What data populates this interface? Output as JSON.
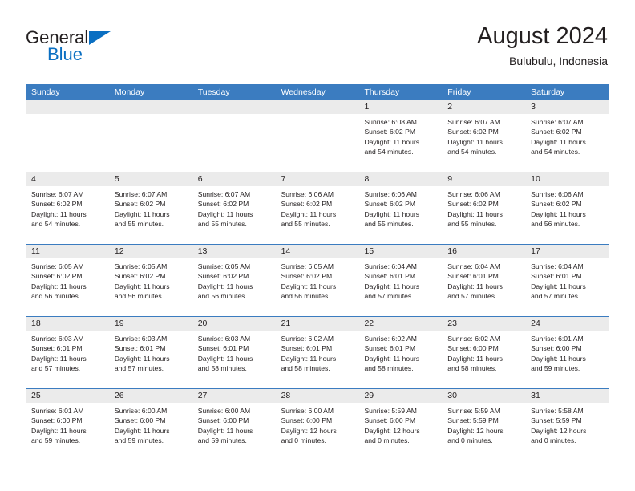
{
  "brand": {
    "name_part1": "General",
    "name_part2": "Blue",
    "logo_icon": "triangle-flag-icon",
    "accent_color": "#0a6fc2"
  },
  "header": {
    "title": "August 2024",
    "subtitle": "Bulubulu, Indonesia"
  },
  "calendar": {
    "header_bg_color": "#3b7cc0",
    "day_band_color": "#ebebeb",
    "day_names": [
      "Sunday",
      "Monday",
      "Tuesday",
      "Wednesday",
      "Thursday",
      "Friday",
      "Saturday"
    ],
    "weeks": [
      [
        {
          "day": "",
          "empty": true,
          "sunrise": "",
          "sunset": "",
          "daylight_line1": "",
          "daylight_line2": ""
        },
        {
          "day": "",
          "empty": true,
          "sunrise": "",
          "sunset": "",
          "daylight_line1": "",
          "daylight_line2": ""
        },
        {
          "day": "",
          "empty": true,
          "sunrise": "",
          "sunset": "",
          "daylight_line1": "",
          "daylight_line2": ""
        },
        {
          "day": "",
          "empty": true,
          "sunrise": "",
          "sunset": "",
          "daylight_line1": "",
          "daylight_line2": ""
        },
        {
          "day": "1",
          "sunrise": "Sunrise: 6:08 AM",
          "sunset": "Sunset: 6:02 PM",
          "daylight_line1": "Daylight: 11 hours",
          "daylight_line2": "and 54 minutes."
        },
        {
          "day": "2",
          "sunrise": "Sunrise: 6:07 AM",
          "sunset": "Sunset: 6:02 PM",
          "daylight_line1": "Daylight: 11 hours",
          "daylight_line2": "and 54 minutes."
        },
        {
          "day": "3",
          "sunrise": "Sunrise: 6:07 AM",
          "sunset": "Sunset: 6:02 PM",
          "daylight_line1": "Daylight: 11 hours",
          "daylight_line2": "and 54 minutes."
        }
      ],
      [
        {
          "day": "4",
          "sunrise": "Sunrise: 6:07 AM",
          "sunset": "Sunset: 6:02 PM",
          "daylight_line1": "Daylight: 11 hours",
          "daylight_line2": "and 54 minutes."
        },
        {
          "day": "5",
          "sunrise": "Sunrise: 6:07 AM",
          "sunset": "Sunset: 6:02 PM",
          "daylight_line1": "Daylight: 11 hours",
          "daylight_line2": "and 55 minutes."
        },
        {
          "day": "6",
          "sunrise": "Sunrise: 6:07 AM",
          "sunset": "Sunset: 6:02 PM",
          "daylight_line1": "Daylight: 11 hours",
          "daylight_line2": "and 55 minutes."
        },
        {
          "day": "7",
          "sunrise": "Sunrise: 6:06 AM",
          "sunset": "Sunset: 6:02 PM",
          "daylight_line1": "Daylight: 11 hours",
          "daylight_line2": "and 55 minutes."
        },
        {
          "day": "8",
          "sunrise": "Sunrise: 6:06 AM",
          "sunset": "Sunset: 6:02 PM",
          "daylight_line1": "Daylight: 11 hours",
          "daylight_line2": "and 55 minutes."
        },
        {
          "day": "9",
          "sunrise": "Sunrise: 6:06 AM",
          "sunset": "Sunset: 6:02 PM",
          "daylight_line1": "Daylight: 11 hours",
          "daylight_line2": "and 55 minutes."
        },
        {
          "day": "10",
          "sunrise": "Sunrise: 6:06 AM",
          "sunset": "Sunset: 6:02 PM",
          "daylight_line1": "Daylight: 11 hours",
          "daylight_line2": "and 56 minutes."
        }
      ],
      [
        {
          "day": "11",
          "sunrise": "Sunrise: 6:05 AM",
          "sunset": "Sunset: 6:02 PM",
          "daylight_line1": "Daylight: 11 hours",
          "daylight_line2": "and 56 minutes."
        },
        {
          "day": "12",
          "sunrise": "Sunrise: 6:05 AM",
          "sunset": "Sunset: 6:02 PM",
          "daylight_line1": "Daylight: 11 hours",
          "daylight_line2": "and 56 minutes."
        },
        {
          "day": "13",
          "sunrise": "Sunrise: 6:05 AM",
          "sunset": "Sunset: 6:02 PM",
          "daylight_line1": "Daylight: 11 hours",
          "daylight_line2": "and 56 minutes."
        },
        {
          "day": "14",
          "sunrise": "Sunrise: 6:05 AM",
          "sunset": "Sunset: 6:02 PM",
          "daylight_line1": "Daylight: 11 hours",
          "daylight_line2": "and 56 minutes."
        },
        {
          "day": "15",
          "sunrise": "Sunrise: 6:04 AM",
          "sunset": "Sunset: 6:01 PM",
          "daylight_line1": "Daylight: 11 hours",
          "daylight_line2": "and 57 minutes."
        },
        {
          "day": "16",
          "sunrise": "Sunrise: 6:04 AM",
          "sunset": "Sunset: 6:01 PM",
          "daylight_line1": "Daylight: 11 hours",
          "daylight_line2": "and 57 minutes."
        },
        {
          "day": "17",
          "sunrise": "Sunrise: 6:04 AM",
          "sunset": "Sunset: 6:01 PM",
          "daylight_line1": "Daylight: 11 hours",
          "daylight_line2": "and 57 minutes."
        }
      ],
      [
        {
          "day": "18",
          "sunrise": "Sunrise: 6:03 AM",
          "sunset": "Sunset: 6:01 PM",
          "daylight_line1": "Daylight: 11 hours",
          "daylight_line2": "and 57 minutes."
        },
        {
          "day": "19",
          "sunrise": "Sunrise: 6:03 AM",
          "sunset": "Sunset: 6:01 PM",
          "daylight_line1": "Daylight: 11 hours",
          "daylight_line2": "and 57 minutes."
        },
        {
          "day": "20",
          "sunrise": "Sunrise: 6:03 AM",
          "sunset": "Sunset: 6:01 PM",
          "daylight_line1": "Daylight: 11 hours",
          "daylight_line2": "and 58 minutes."
        },
        {
          "day": "21",
          "sunrise": "Sunrise: 6:02 AM",
          "sunset": "Sunset: 6:01 PM",
          "daylight_line1": "Daylight: 11 hours",
          "daylight_line2": "and 58 minutes."
        },
        {
          "day": "22",
          "sunrise": "Sunrise: 6:02 AM",
          "sunset": "Sunset: 6:01 PM",
          "daylight_line1": "Daylight: 11 hours",
          "daylight_line2": "and 58 minutes."
        },
        {
          "day": "23",
          "sunrise": "Sunrise: 6:02 AM",
          "sunset": "Sunset: 6:00 PM",
          "daylight_line1": "Daylight: 11 hours",
          "daylight_line2": "and 58 minutes."
        },
        {
          "day": "24",
          "sunrise": "Sunrise: 6:01 AM",
          "sunset": "Sunset: 6:00 PM",
          "daylight_line1": "Daylight: 11 hours",
          "daylight_line2": "and 59 minutes."
        }
      ],
      [
        {
          "day": "25",
          "sunrise": "Sunrise: 6:01 AM",
          "sunset": "Sunset: 6:00 PM",
          "daylight_line1": "Daylight: 11 hours",
          "daylight_line2": "and 59 minutes."
        },
        {
          "day": "26",
          "sunrise": "Sunrise: 6:00 AM",
          "sunset": "Sunset: 6:00 PM",
          "daylight_line1": "Daylight: 11 hours",
          "daylight_line2": "and 59 minutes."
        },
        {
          "day": "27",
          "sunrise": "Sunrise: 6:00 AM",
          "sunset": "Sunset: 6:00 PM",
          "daylight_line1": "Daylight: 11 hours",
          "daylight_line2": "and 59 minutes."
        },
        {
          "day": "28",
          "sunrise": "Sunrise: 6:00 AM",
          "sunset": "Sunset: 6:00 PM",
          "daylight_line1": "Daylight: 12 hours",
          "daylight_line2": "and 0 minutes."
        },
        {
          "day": "29",
          "sunrise": "Sunrise: 5:59 AM",
          "sunset": "Sunset: 6:00 PM",
          "daylight_line1": "Daylight: 12 hours",
          "daylight_line2": "and 0 minutes."
        },
        {
          "day": "30",
          "sunrise": "Sunrise: 5:59 AM",
          "sunset": "Sunset: 5:59 PM",
          "daylight_line1": "Daylight: 12 hours",
          "daylight_line2": "and 0 minutes."
        },
        {
          "day": "31",
          "sunrise": "Sunrise: 5:58 AM",
          "sunset": "Sunset: 5:59 PM",
          "daylight_line1": "Daylight: 12 hours",
          "daylight_line2": "and 0 minutes."
        }
      ]
    ]
  }
}
